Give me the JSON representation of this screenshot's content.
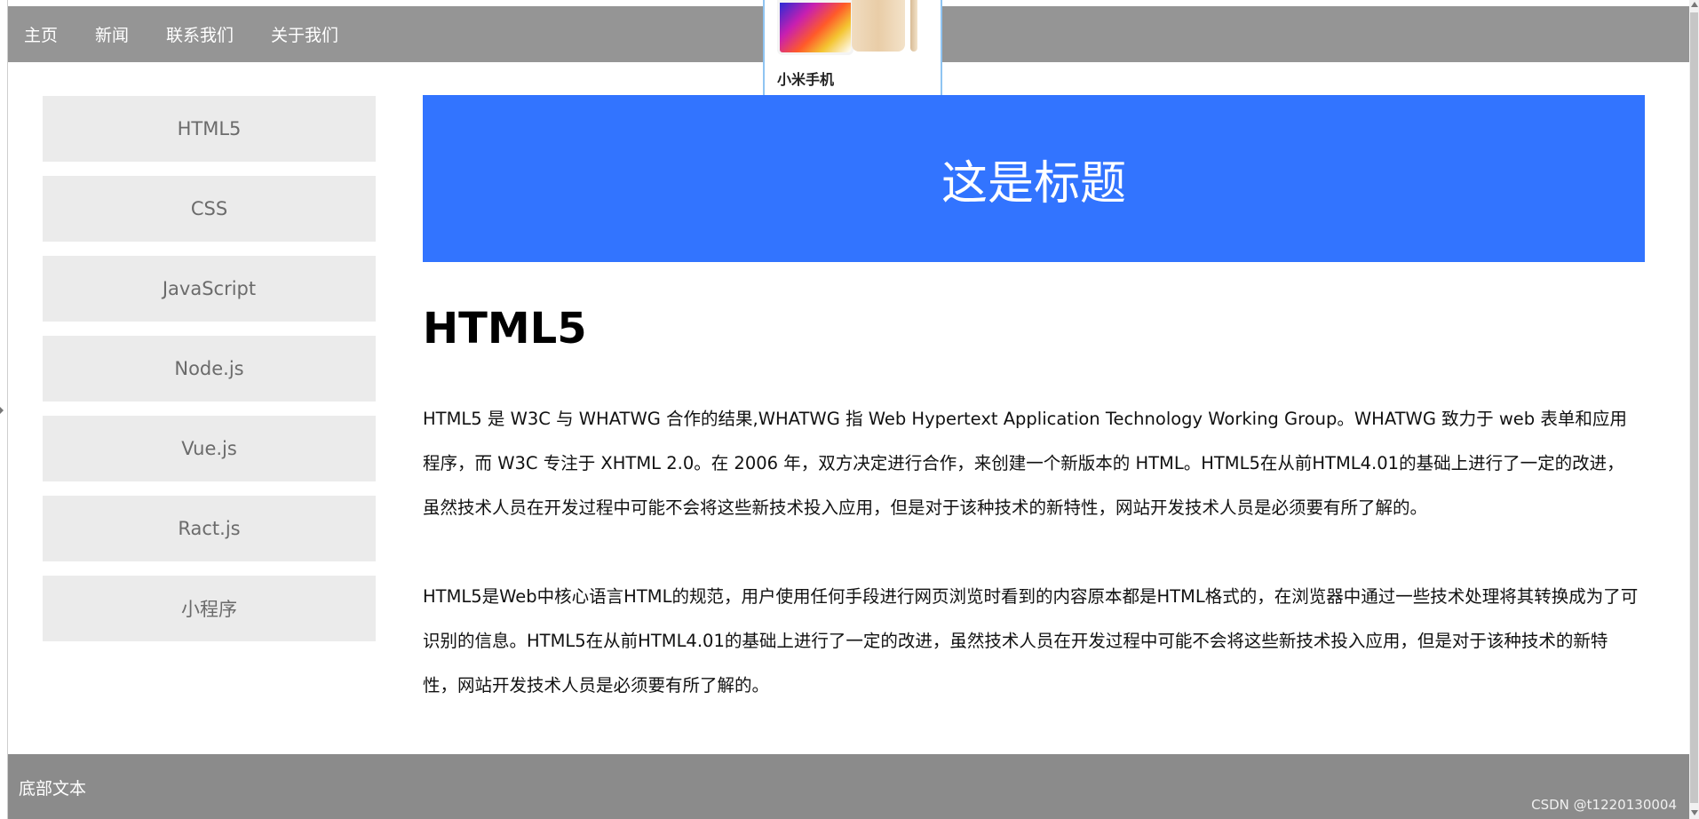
{
  "nav": {
    "items": [
      "主页",
      "新闻",
      "联系我们",
      "关于我们"
    ]
  },
  "popup": {
    "product_name": "小米手机"
  },
  "sidebar": {
    "items": [
      "HTML5",
      "CSS",
      "JavaScript",
      "Node.js",
      "Vue.js",
      "Ract.js",
      "小程序"
    ]
  },
  "banner": {
    "title": "这是标题"
  },
  "content": {
    "heading": "HTML5",
    "paragraphs": [
      "HTML5 是 W3C 与 WHATWG 合作的结果,WHATWG 指 Web Hypertext Application Technology Working Group。WHATWG 致力于 web 表单和应用程序，而 W3C 专注于 XHTML 2.0。在 2006 年，双方决定进行合作，来创建一个新版本的 HTML。HTML5在从前HTML4.01的基础上进行了一定的改进，虽然技术人员在开发过程中可能不会将这些新技术投入应用，但是对于该种技术的新特性，网站开发技术人员是必须要有所了解的。",
      "HTML5是Web中核心语言HTML的规范，用户使用任何手段进行网页浏览时看到的内容原本都是HTML格式的，在浏览器中通过一些技术处理将其转换成为了可识别的信息。HTML5在从前HTML4.01的基础上进行了一定的改进，虽然技术人员在开发过程中可能不会将这些新技术投入应用，但是对于该种技术的新特性，网站开发技术人员是必须要有所了解的。"
    ]
  },
  "footer": {
    "text": "底部文本",
    "watermark": "CSDN @t1220130004"
  },
  "colors": {
    "nav_bg": "#959595",
    "banner_bg": "#3274ff",
    "sidebar_item_bg": "#ebebeb",
    "footer_bg": "#8b8b8b"
  },
  "icons": {
    "popup_image": "xiaomi-phone-image"
  }
}
